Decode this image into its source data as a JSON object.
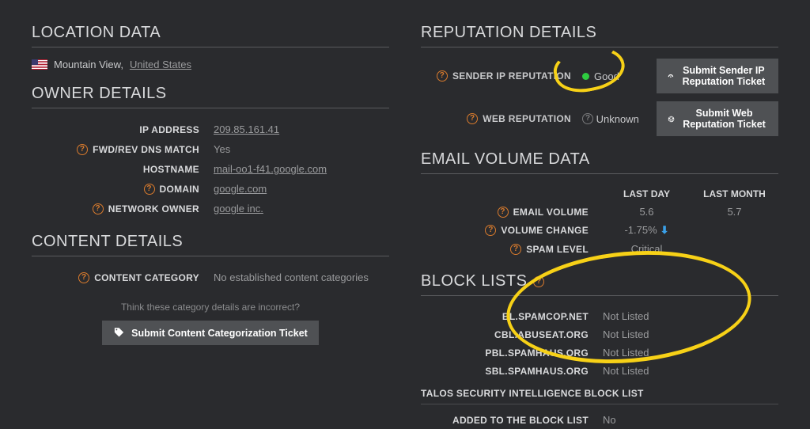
{
  "location": {
    "heading": "LOCATION DATA",
    "city": "Mountain View,",
    "country": "United States"
  },
  "owner": {
    "heading": "OWNER DETAILS",
    "rows": {
      "ip_label": "IP ADDRESS",
      "ip_value": "209.85.161.41",
      "dns_label": "FWD/REV DNS MATCH",
      "dns_value": "Yes",
      "host_label": "HOSTNAME",
      "host_value": "mail-oo1-f41.google.com",
      "domain_label": "DOMAIN",
      "domain_value": "google.com",
      "netown_label": "NETWORK OWNER",
      "netown_value": "google inc."
    }
  },
  "content": {
    "heading": "CONTENT DETAILS",
    "cat_label": "CONTENT CATEGORY",
    "cat_value": "No established content categories",
    "hint": "Think these category details are incorrect?",
    "btn": "Submit Content Categorization Ticket"
  },
  "reputation": {
    "heading": "REPUTATION DETAILS",
    "sender_label": "SENDER IP REPUTATION",
    "sender_value": "Good",
    "web_label": "WEB REPUTATION",
    "web_value": "Unknown",
    "btn_sender": "Submit Sender IP Reputation Ticket",
    "btn_web": "Submit Web Reputation Ticket"
  },
  "volume": {
    "heading": "EMAIL VOLUME DATA",
    "col1": "LAST DAY",
    "col2": "LAST MONTH",
    "rows": {
      "vol_label": "EMAIL VOLUME",
      "vol_d": "5.6",
      "vol_m": "5.7",
      "chg_label": "VOLUME CHANGE",
      "chg_d": "-1.75%",
      "spam_label": "SPAM LEVEL",
      "spam_d": "Critical"
    }
  },
  "block": {
    "heading": "BLOCK LISTS",
    "rows": [
      {
        "name": "BL.SPAMCOP.NET",
        "status": "Not Listed"
      },
      {
        "name": "CBL.ABUSEAT.ORG",
        "status": "Not Listed"
      },
      {
        "name": "PBL.SPAMHAUS.ORG",
        "status": "Not Listed"
      },
      {
        "name": "SBL.SPAMHAUS.ORG",
        "status": "Not Listed"
      }
    ],
    "talos_heading": "TALOS SECURITY INTELLIGENCE BLOCK LIST",
    "added_label": "ADDED TO THE BLOCK LIST",
    "added_value": "No"
  }
}
